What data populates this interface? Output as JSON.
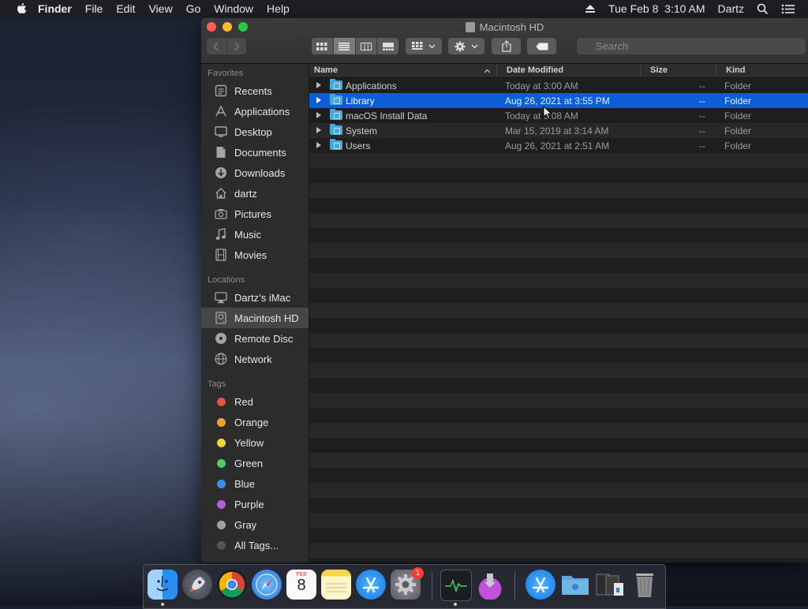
{
  "menubar": {
    "items": [
      "Finder",
      "File",
      "Edit",
      "View",
      "Go",
      "Window",
      "Help"
    ],
    "clock": "Tue Feb 8  3:10 AM",
    "user": "Dartz"
  },
  "window": {
    "title": "Macintosh HD",
    "search_placeholder": "Search"
  },
  "sidebar": {
    "favorites_label": "Favorites",
    "favorites": [
      {
        "label": "Recents",
        "icon": "clock-icon"
      },
      {
        "label": "Applications",
        "icon": "applications-icon"
      },
      {
        "label": "Desktop",
        "icon": "desktop-icon"
      },
      {
        "label": "Documents",
        "icon": "document-icon"
      },
      {
        "label": "Downloads",
        "icon": "download-icon"
      },
      {
        "label": "dartz",
        "icon": "home-icon"
      },
      {
        "label": "Pictures",
        "icon": "camera-icon"
      },
      {
        "label": "Music",
        "icon": "music-icon"
      },
      {
        "label": "Movies",
        "icon": "film-icon"
      }
    ],
    "locations_label": "Locations",
    "locations": [
      {
        "label": "Dartz’s iMac",
        "icon": "computer-icon"
      },
      {
        "label": "Macintosh HD",
        "icon": "hard-drive-icon",
        "selected": true
      },
      {
        "label": "Remote Disc",
        "icon": "disc-icon"
      },
      {
        "label": "Network",
        "icon": "network-icon"
      }
    ],
    "tags_label": "Tags",
    "tags": [
      {
        "label": "Red",
        "color": "#e5534b"
      },
      {
        "label": "Orange",
        "color": "#f0a030"
      },
      {
        "label": "Yellow",
        "color": "#f2d43c"
      },
      {
        "label": "Green",
        "color": "#4fce5d"
      },
      {
        "label": "Blue",
        "color": "#3b8ef0"
      },
      {
        "label": "Purple",
        "color": "#b55ce0"
      },
      {
        "label": "Gray",
        "color": "#a0a0a0"
      },
      {
        "label": "All Tags...",
        "color": "#555555"
      }
    ]
  },
  "list": {
    "columns": [
      "Name",
      "Date Modified",
      "Size",
      "Kind"
    ],
    "rows": [
      {
        "name": "Applications",
        "date": "Today at 3:00 AM",
        "size": "--",
        "kind": "Folder"
      },
      {
        "name": "Library",
        "date": "Aug 26, 2021 at 3:55 PM",
        "size": "--",
        "kind": "Folder",
        "selected": true
      },
      {
        "name": "macOS Install Data",
        "date": "Today at 3:08 AM",
        "size": "--",
        "kind": "Folder"
      },
      {
        "name": "System",
        "date": "Mar 15, 2019 at 3:14 AM",
        "size": "--",
        "kind": "Folder"
      },
      {
        "name": "Users",
        "date": "Aug 26, 2021 at 2:51 AM",
        "size": "--",
        "kind": "Folder"
      }
    ]
  },
  "calendar": {
    "month": "FEB",
    "day": "8"
  },
  "dock": {
    "badge": "1",
    "apps": [
      "finder-icon",
      "launchpad-icon",
      "chrome-icon",
      "safari-icon",
      "calendar-icon",
      "notes-icon",
      "app-store-icon",
      "system-preferences-icon",
      "activity-monitor-icon",
      "installer-icon",
      "app-store-icon",
      "folder-icon",
      "files-icon",
      "trash-icon"
    ]
  }
}
